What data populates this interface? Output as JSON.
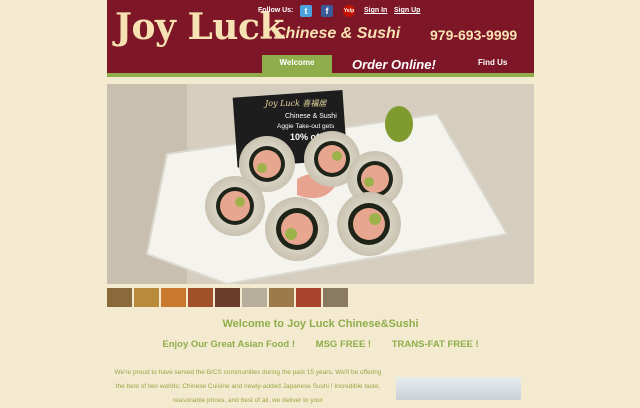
{
  "header": {
    "logo": "Joy Luck",
    "tagline": "Chinese & Sushi",
    "phone": "979-693-9999",
    "follow_label": "Follow Us:",
    "social": {
      "twitter": "t",
      "facebook": "f",
      "yelp": "Yelp"
    },
    "sign_in": "Sign In",
    "sign_up": "Sign Up"
  },
  "nav": {
    "welcome": "Welcome",
    "order": "Order Online!",
    "find": "Find Us"
  },
  "photo": {
    "card_brand": "Joy Luck 喜福居",
    "card_line1": "Chinese & Sushi",
    "card_line2": "Aggie Take-out gets",
    "card_offer": "10% off!!*"
  },
  "content": {
    "welcome_heading": "Welcome to Joy Luck Chinese&Sushi",
    "enjoy": "Enjoy Our Great Asian Food !",
    "msg": "MSG FREE !",
    "transfat": "TRANS-FAT FREE !",
    "intro": "We're proud to have served the B/CS communities during the past 15 years. We'll be offering the best of two worlds: Chinese Cuisine and newly-added Japanese Sushi ! Incredible taste, reasonable prices, and best of all, we deliver to your"
  },
  "colors": {
    "maroon": "#7d1626",
    "green": "#8fae4b",
    "cream": "#f3ead0"
  }
}
